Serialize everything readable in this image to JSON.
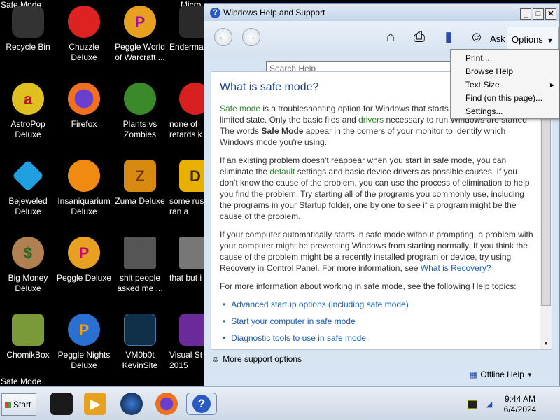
{
  "desktop": {
    "safe_mode_tl": "Safe Mode",
    "safe_mode_bl": "Safe Mode",
    "safe_mode_top_partial": "Micro",
    "icons": [
      {
        "label": "Recycle Bin",
        "name": "recycle-bin-icon"
      },
      {
        "label": "Chuzzle\nDeluxe",
        "name": "chuzzle-icon"
      },
      {
        "label": "Peggle World\nof Warcraft ...",
        "name": "peggle-wow-icon"
      },
      {
        "label": "Enderma",
        "name": "enderman-icon"
      },
      {
        "label": "AstroPop\nDeluxe",
        "name": "astropop-icon"
      },
      {
        "label": "Firefox",
        "name": "firefox-icon"
      },
      {
        "label": "Plants vs\nZombies",
        "name": "plants-vs-zombies-icon"
      },
      {
        "label": "none of\nretards k",
        "name": "none-of-retards-icon"
      },
      {
        "label": "Bejeweled\nDeluxe",
        "name": "bejeweled-icon"
      },
      {
        "label": "Insaniquarium\nDeluxe",
        "name": "insaniquarium-icon"
      },
      {
        "label": "Zuma Deluxe",
        "name": "zuma-icon"
      },
      {
        "label": "some rus\nran a",
        "name": "some-rus-icon"
      },
      {
        "label": "Big Money\nDeluxe",
        "name": "big-money-icon"
      },
      {
        "label": "Peggle Deluxe",
        "name": "peggle-deluxe-icon"
      },
      {
        "label": "shit people\nasked me ...",
        "name": "folder-icon"
      },
      {
        "label": "that but i",
        "name": "that-but-icon"
      },
      {
        "label": "ChomikBox",
        "name": "chomikbox-icon"
      },
      {
        "label": "Peggle Nights\nDeluxe",
        "name": "peggle-nights-icon"
      },
      {
        "label": "VM0b0t\nKevinSite",
        "name": "vm0b0t-icon"
      },
      {
        "label": "Visual St\n2015",
        "name": "visual-studio-icon"
      }
    ]
  },
  "window": {
    "title": "Windows Help and Support",
    "ask_label": "Ask",
    "options_label": "Options",
    "search_placeholder": "Search Help",
    "article": {
      "heading": "What is safe mode?",
      "p1_link": "Safe mode",
      "p1_a": " is a troubleshooting option for Windows that starts your computer in a limited state. Only the basic files and ",
      "p1_drivers": "drivers",
      "p1_b": " necessary to run Windows are started. The words ",
      "p1_bold": "Safe Mode",
      "p1_c": " appear in the corners of your monitor to identify which Windows mode you're using.",
      "p2_a": "If an existing problem doesn't reappear when you start in safe mode, you can eliminate the ",
      "p2_default": "default",
      "p2_b": " settings and basic device drivers as possible causes. If you don't know the cause of the problem, you can use the process of elimination to help you find the problem. Try starting all of the programs you commonly use, including the programs in your Startup folder, one by one to see if a program might be the cause of the problem.",
      "p3_a": "If your computer automatically starts in safe mode without prompting, a problem with your computer might be preventing Windows from starting normally. If you think the cause of the problem might be a recently installed program or device, try using Recovery in Control Panel. For more information, see ",
      "p3_link": "What is Recovery?",
      "p4": "For more information about working in safe mode, see the following Help topics:",
      "links": [
        "Advanced startup options (including safe mode)",
        "Start your computer in safe mode",
        "Diagnostic tools to use in safe mode"
      ]
    },
    "more_support": "More support options",
    "offline_help": "Offline Help"
  },
  "options_menu": {
    "items": [
      "Print...",
      "Browse Help",
      "Text Size",
      "Find (on this page)...",
      "Settings..."
    ]
  },
  "taskbar": {
    "start_label": "Start",
    "time": "9:44 AM",
    "date": "6/4/2024"
  }
}
